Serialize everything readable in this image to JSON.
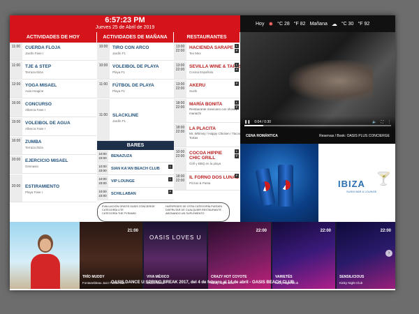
{
  "header": {
    "time": "6:57:23 PM",
    "date": "Jueves 25 de Abril de 2019"
  },
  "weather": {
    "today_label": "Hoy",
    "today_high": "°C 28",
    "today_low": "°F 82",
    "tomorrow_label": "Mañana",
    "tomorrow_high": "°C 30",
    "tomorrow_low": "°F 92"
  },
  "columns": {
    "today": "ACTIVIDADES DE HOY",
    "tomorrow": "ACTIVIDADES DE MAÑANA",
    "restaurants": "RESTAURANTES",
    "bars": "BARES"
  },
  "activities_today": [
    {
      "time": "11:00",
      "name": "CUERDA FLOJA",
      "location": "Jardín Fase I"
    },
    {
      "time": "11:00",
      "name": "TJE & STEP",
      "location": "Terraza Ibiza"
    },
    {
      "time": "12:00",
      "name": "YOGA MISAEL",
      "location": "Aula Imagine"
    },
    {
      "time": "16:00",
      "name": "CONCURSO",
      "location": "Alberca Fase I"
    },
    {
      "time": "15:00",
      "name": "VOLEIBOL DE AGUA",
      "location": "Alberca Fase I"
    },
    {
      "time": "16:00",
      "name": "ZUMBA",
      "location": "Terraza Ibiza"
    },
    {
      "time": "20:00",
      "name": "EJERCICIO MISAEL",
      "location": "Gimnasio"
    },
    {
      "time": "20:00",
      "name": "ESTIRAMIENTO",
      "location": "Playa Fase I"
    }
  ],
  "activities_tomorrow": [
    {
      "time": "10:00",
      "name": "TIRO CON ARCO",
      "location": "Jardín F1"
    },
    {
      "time": "10:00",
      "name": "VOLEIBOL DE PLAYA",
      "location": "Playa F1"
    },
    {
      "time": "11:00",
      "name": "FÚTBOL DE PLAYA",
      "location": "Playa F1"
    },
    {
      "time": "11:00",
      "name": "SLACKLINE",
      "location": "Jardín F1"
    }
  ],
  "bars": [
    {
      "time": "10:00 23:00",
      "name": "BENAZUZA"
    },
    {
      "time": "10:00 23:00",
      "name": "SIAN KA'AN BEACH CLUB"
    },
    {
      "time": "10:00 23:00",
      "name": "VIP LOUNGE"
    },
    {
      "time": "10:00 23:00",
      "name": "SCHILLABAN"
    }
  ],
  "restaurants": [
    {
      "time": "13:00 22:00",
      "name": "HACIENDA SARAPE",
      "desc": "Tex Mex"
    },
    {
      "time": "13:00 22:00",
      "name": "SEVILLA WINE & TAPAS",
      "desc": "Cocina Española"
    },
    {
      "time": "13:00 22:00",
      "name": "AKERU",
      "desc": "Sushi"
    },
    {
      "time": "18:00 22:00",
      "name": "MARÍA BONITA",
      "desc": "Restaurante mexicano con show y mariachi"
    },
    {
      "time": "18:00 22:00",
      "name": "LA PLACITA",
      "desc": "Mr. Whimsy / Happy Chicken / Tacos & Tortas"
    },
    {
      "time": "10:00 22:00",
      "name": "COCOA HIPPIE CHIC GRILL",
      "desc": "Grill y BBQ en la playa"
    },
    {
      "time": "18:00 22:00",
      "name": "IL FORNO DOS LUNAS",
      "desc": "Pizzas & Pasta"
    }
  ],
  "legend": {
    "left_1": "EVALUACIÓN GRATIS OASIS CONCIERGE",
    "left_2": "CATEGORÍA LITE",
    "left_3": "CATEGORÍA THE PYRAMID",
    "right": "HUÉSPEDES DE OTRA CATEGORÍA PUEDEN DISFRUTAR DE CUALQUIER RESTAURANTE ABONANDO UN SUPLEMENTO"
  },
  "video": {
    "elapsed": "0:04 / 0:30",
    "progress": 0.13,
    "caption_title": "CENA ROMÁNTICA",
    "caption_right": "Reservas / Book: OASIS PLUS CONCIERGE"
  },
  "ads": {
    "ibiza_word": "IBIZA",
    "ibiza_sub": "SUSHI BAR & LOUNGE"
  },
  "shows": [
    {
      "time": "21:00",
      "title": "TRÍO MUDDY",
      "location": "Fontanebleau Jazz Fusion Bar",
      "color": "#4a2b1f"
    },
    {
      "time": "21:00",
      "title": "VIVA MÉXICO",
      "location": "Oasis Arena",
      "color": "#5a2a66"
    },
    {
      "time": "22:00",
      "title": "CRAZY HOT COYOTE",
      "location": "Kinky Night Club",
      "color": "#6a1d5a"
    },
    {
      "time": "22:00",
      "title": "VARIETÉS",
      "location": "Kinky Night Club",
      "color": "#3b1a7a"
    },
    {
      "time": "22:00",
      "title": "SENSILICIOUS",
      "location": "Kinky Night Club",
      "color": "#2a1a6a"
    }
  ],
  "show_banner_text": "OASIS LOVES U",
  "footer": "OASIS DANCE U:SPRING BREAK 2017, del 4 de febrero al 14 de abril - OASIS BEACH CLUB"
}
